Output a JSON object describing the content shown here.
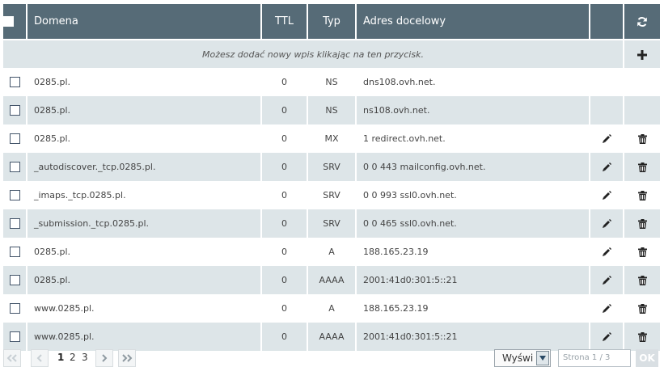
{
  "table": {
    "columns": {
      "domain": "Domena",
      "ttl": "TTL",
      "type": "Typ",
      "target": "Adres docelowy"
    },
    "add_hint": "Możesz dodać nowy wpis klikając na ten przycisk.",
    "rows": [
      {
        "domain": "0285.pl.",
        "ttl": "0",
        "type": "NS",
        "target": "dns108.ovh.net."
      },
      {
        "domain": "0285.pl.",
        "ttl": "0",
        "type": "NS",
        "target": "ns108.ovh.net."
      },
      {
        "domain": "0285.pl.",
        "ttl": "0",
        "type": "MX",
        "target": "1 redirect.ovh.net."
      },
      {
        "domain": "_autodiscover._tcp.0285.pl.",
        "ttl": "0",
        "type": "SRV",
        "target": "0 0 443 mailconfig.ovh.net."
      },
      {
        "domain": "_imaps._tcp.0285.pl.",
        "ttl": "0",
        "type": "SRV",
        "target": "0 0 993 ssl0.ovh.net."
      },
      {
        "domain": "_submission._tcp.0285.pl.",
        "ttl": "0",
        "type": "SRV",
        "target": "0 0 465 ssl0.ovh.net."
      },
      {
        "domain": "0285.pl.",
        "ttl": "0",
        "type": "A",
        "target": "188.165.23.19"
      },
      {
        "domain": "0285.pl.",
        "ttl": "0",
        "type": "AAAA",
        "target": "2001:41d0:301:5::21"
      },
      {
        "domain": "www.0285.pl.",
        "ttl": "0",
        "type": "A",
        "target": "188.165.23.19"
      },
      {
        "domain": "www.0285.pl.",
        "ttl": "0",
        "type": "AAAA",
        "target": "2001:41d0:301:5::21"
      }
    ]
  },
  "pager": {
    "pages": [
      "1",
      "2",
      "3"
    ],
    "current_page": "1",
    "display_select": "Wyświ",
    "page_input_placeholder": "Strona 1 / 3",
    "ok_label": "OK"
  },
  "colors": {
    "header_bg": "#566b77",
    "stripe_bg": "#dde5e8",
    "icon_color": "#222222"
  }
}
